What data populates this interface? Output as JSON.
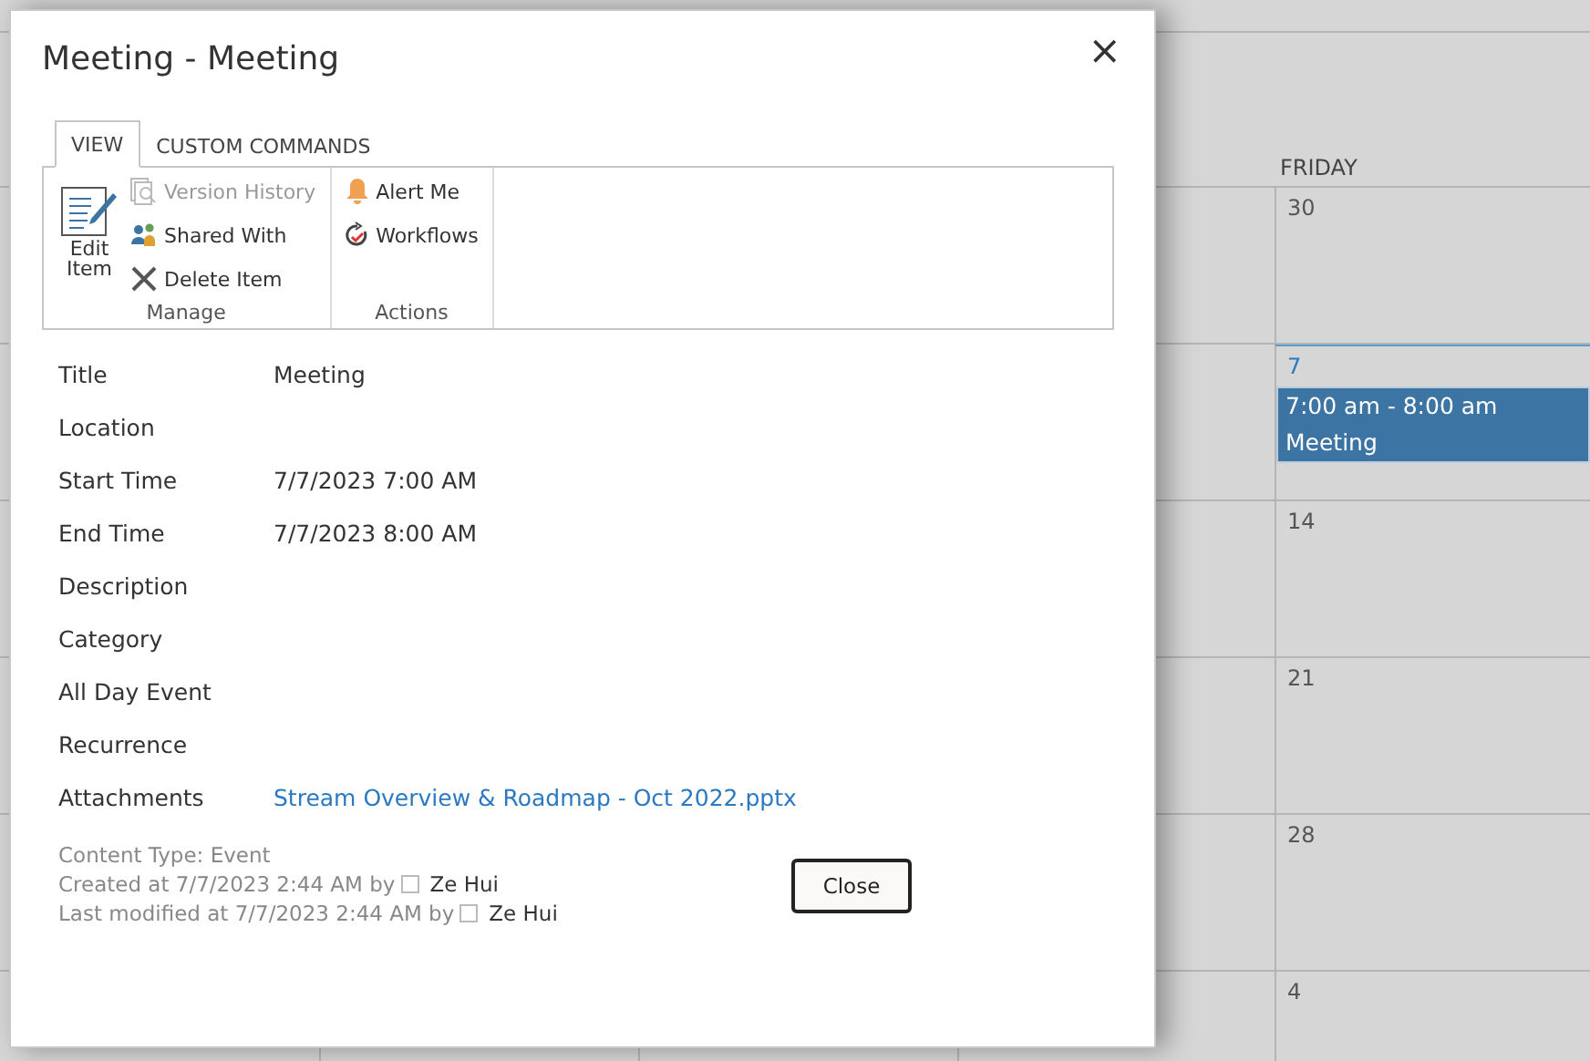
{
  "calendar": {
    "day_heading": "FRIDAY",
    "days": [
      {
        "number": "30",
        "today": false
      },
      {
        "number": "7",
        "today": true,
        "events": [
          {
            "time": "7:00 am - 8:00 am",
            "title": "Meeting"
          }
        ]
      },
      {
        "number": "14",
        "today": false
      },
      {
        "number": "21",
        "today": false
      },
      {
        "number": "28",
        "today": false
      },
      {
        "number": "4",
        "today": false
      }
    ]
  },
  "dialog": {
    "title": "Meeting - Meeting",
    "close_icon": "×",
    "tabs": [
      {
        "label": "VIEW",
        "selected": true
      },
      {
        "label": "CUSTOM COMMANDS",
        "selected": false
      }
    ],
    "ribbon": {
      "groups": [
        {
          "label": "Manage",
          "large": {
            "label_lines": [
              "Edit",
              "Item"
            ]
          },
          "items": [
            {
              "label": "Version History",
              "disabled": true
            },
            {
              "label": "Shared With",
              "disabled": false
            },
            {
              "label": "Delete Item",
              "disabled": false
            }
          ]
        },
        {
          "label": "Actions",
          "items": [
            {
              "label": "Alert Me",
              "disabled": false
            },
            {
              "label": "Workflows",
              "disabled": false
            }
          ]
        }
      ]
    },
    "fields": [
      {
        "label": "Title",
        "value": "Meeting"
      },
      {
        "label": "Location"
      },
      {
        "label": "Start Time",
        "value": "7/7/2023 7:00 AM"
      },
      {
        "label": "End Time",
        "value": "7/7/2023 8:00 AM"
      },
      {
        "label": "Description"
      },
      {
        "label": "Category"
      },
      {
        "label": "All Day Event"
      },
      {
        "label": "Recurrence"
      },
      {
        "label": "Attachments",
        "link": "Stream Overview & Roadmap - Oct 2022.pptx"
      }
    ],
    "footer": {
      "content_type": "Content Type: Event",
      "created": "Created at 7/7/2023 2:44 AM by",
      "created_by": "Ze Hui",
      "modified": "Last modified at 7/7/2023 2:44 AM by",
      "modified_by": "Ze Hui"
    },
    "button": "Close"
  }
}
